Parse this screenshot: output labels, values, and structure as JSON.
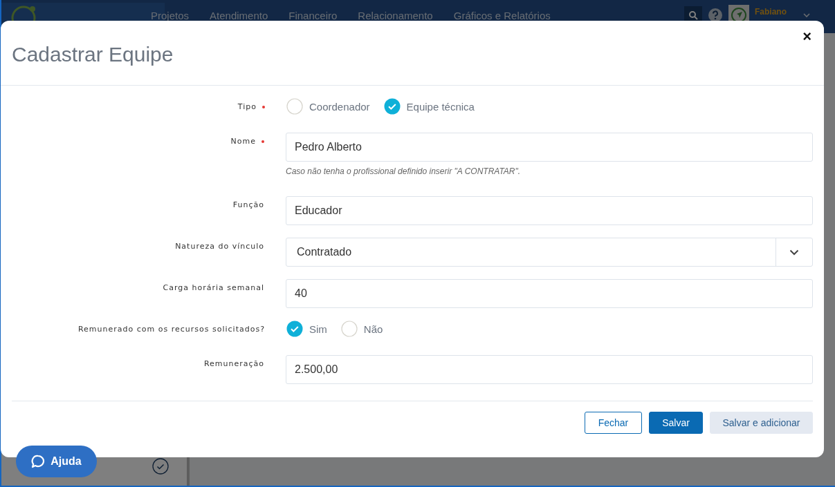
{
  "navbar": {
    "menu": [
      "Projetos",
      "Atendimento",
      "Financeiro",
      "Relacionamento",
      "Gráficos e Relatórios"
    ],
    "user": "Fabiano"
  },
  "modal": {
    "title": "Cadastrar Equipe",
    "close": "×",
    "fields": [
      {
        "kind": "radio",
        "label": "Tipo",
        "required": true,
        "options": [
          {
            "label": "Coordenador",
            "selected": false
          },
          {
            "label": "Equipe técnica",
            "selected": true
          }
        ]
      },
      {
        "kind": "text",
        "label": "Nome",
        "required": true,
        "value": "Pedro Alberto",
        "hint": "Caso não tenha o profissional definido inserir \"A CONTRATAR\"."
      },
      {
        "kind": "text",
        "label": "Função",
        "required": false,
        "value": "Educador"
      },
      {
        "kind": "select",
        "label": "Natureza do vínculo",
        "required": false,
        "value": "Contratado"
      },
      {
        "kind": "text",
        "label": "Carga horária semanal",
        "required": false,
        "value": "40"
      },
      {
        "kind": "radio",
        "label": "Remunerado com os recursos solicitados?",
        "required": false,
        "options": [
          {
            "label": "Sim",
            "selected": true
          },
          {
            "label": "Não",
            "selected": false
          }
        ]
      },
      {
        "kind": "text",
        "label": "Remuneração",
        "required": false,
        "value": "2.500,00"
      }
    ],
    "buttons": [
      {
        "label": "Fechar",
        "kind": "outline"
      },
      {
        "label": "Salvar",
        "kind": "primary"
      },
      {
        "label": "Salvar e adicionar",
        "kind": "light"
      }
    ]
  },
  "help": {
    "label": "Ajuda"
  }
}
